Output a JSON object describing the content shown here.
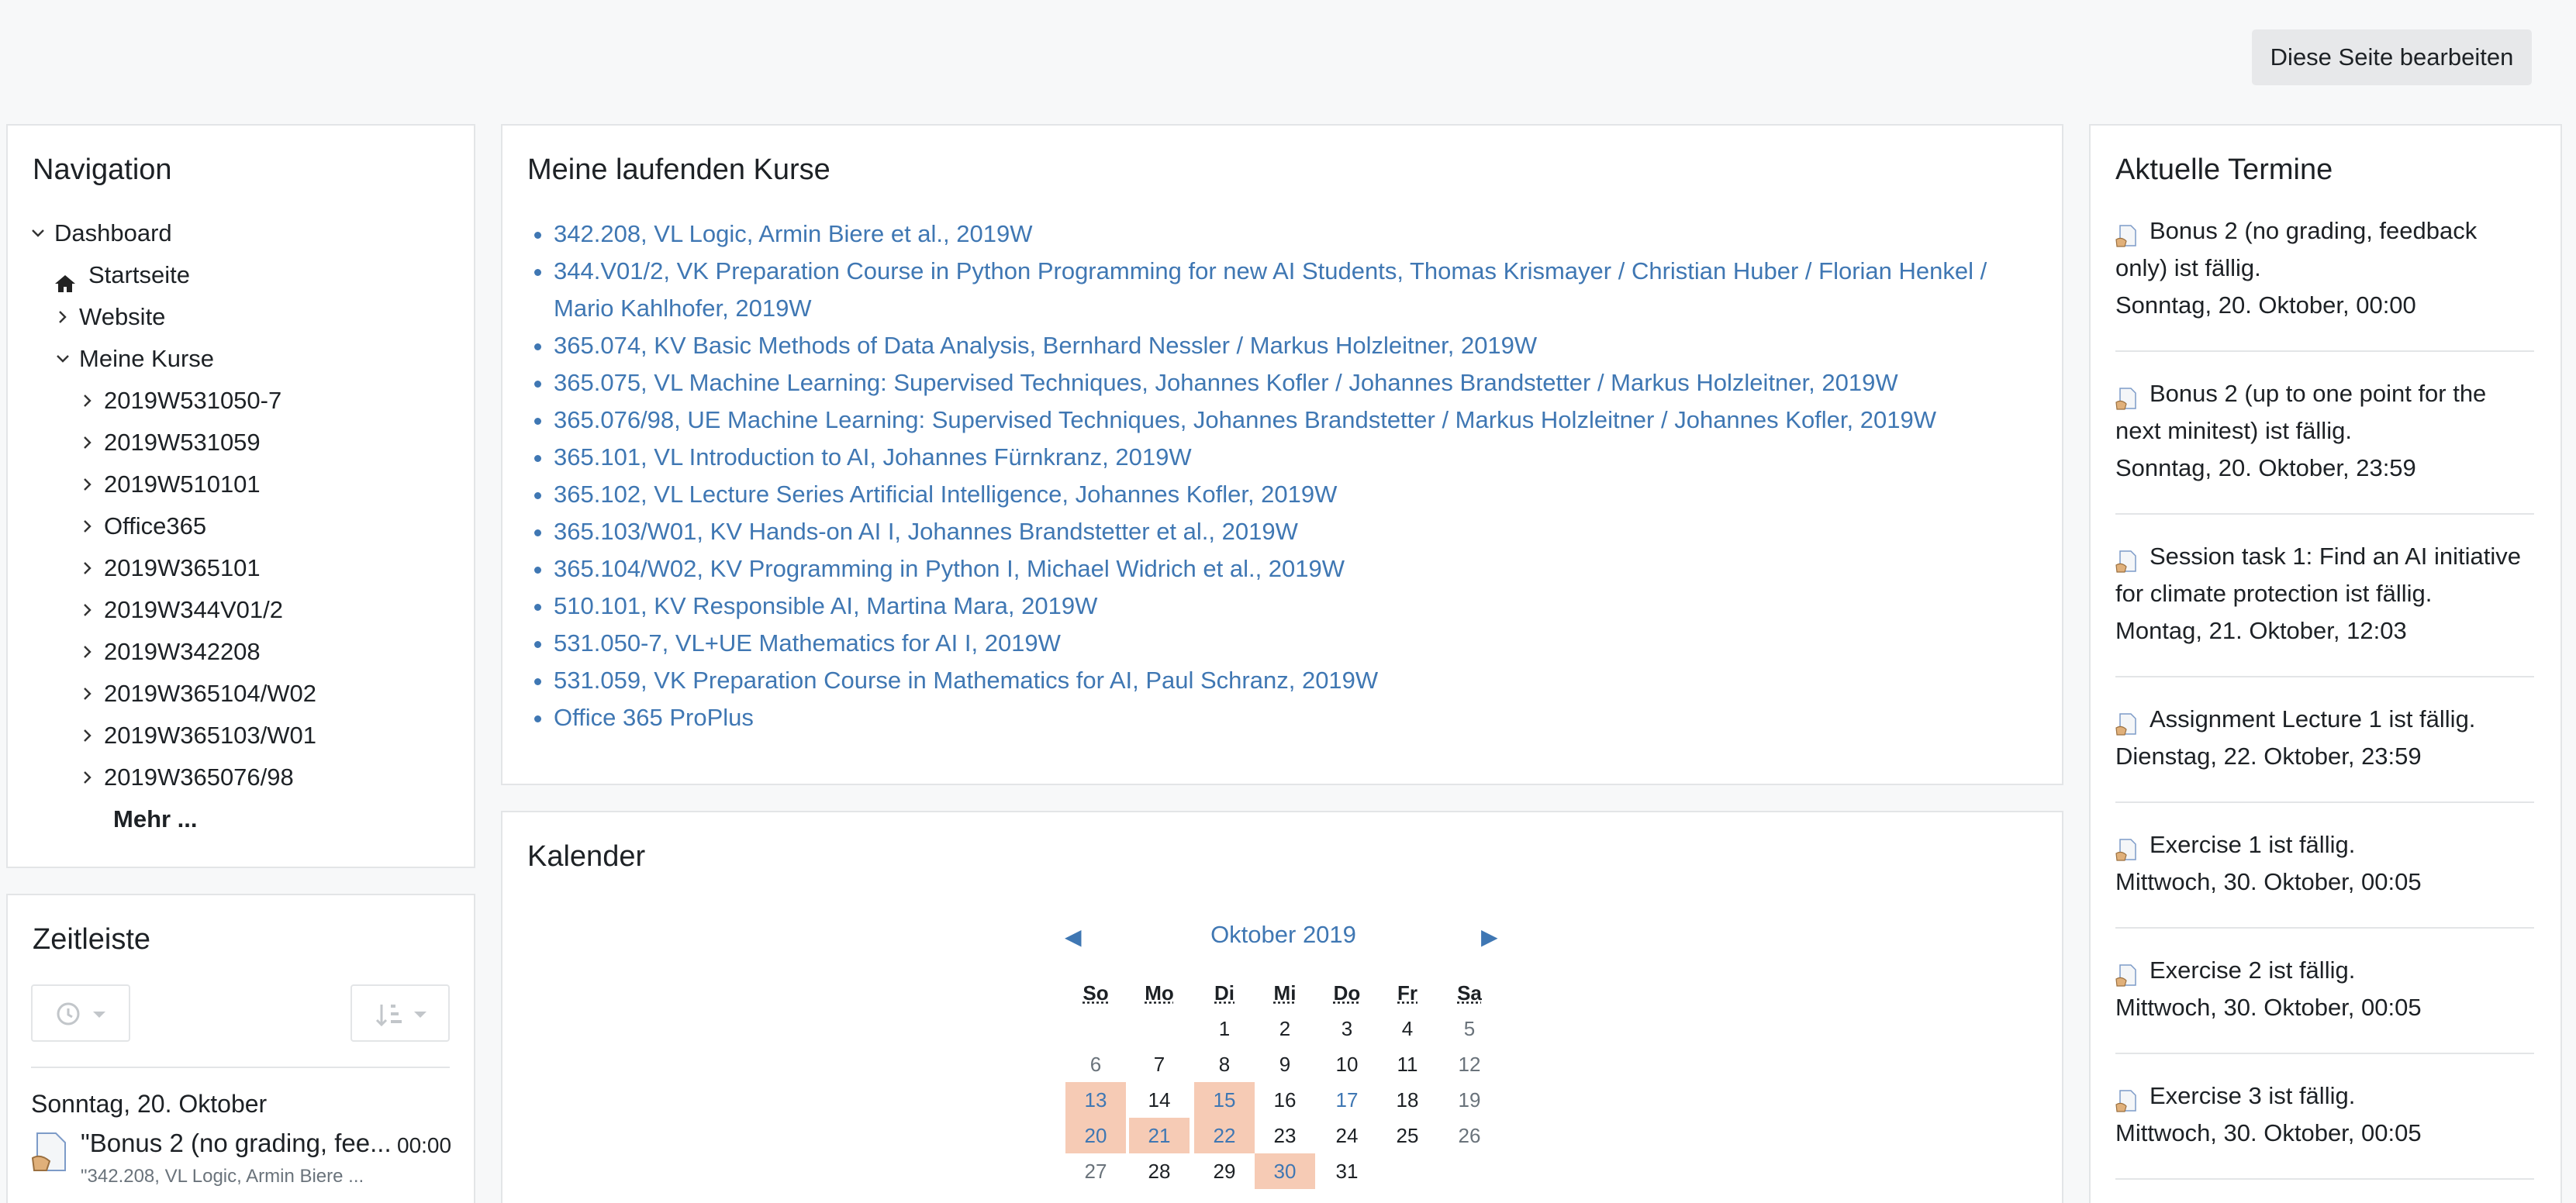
{
  "header": {
    "edit_button": "Diese Seite bearbeiten"
  },
  "navigation": {
    "title": "Navigation",
    "dashboard": "Dashboard",
    "startseite": "Startseite",
    "website": "Website",
    "meine_kurse": "Meine Kurse",
    "courses": [
      "2019W531050-7",
      "2019W531059",
      "2019W510101",
      "Office365",
      "2019W365101",
      "2019W344V01/2",
      "2019W342208",
      "2019W365104/W02",
      "2019W365103/W01",
      "2019W365076/98"
    ],
    "more": "Mehr ..."
  },
  "running_courses": {
    "title": "Meine laufenden Kurse",
    "items": [
      "342.208, VL Logic, Armin Biere et al., 2019W",
      "344.V01/2, VK Preparation Course in Python Programming for new AI Students, Thomas Krismayer / Christian Huber / Florian Henkel / Mario Kahlhofer, 2019W",
      "365.074, KV Basic Methods of Data Analysis, Bernhard Nessler / Markus Holzleitner, 2019W",
      "365.075, VL Machine Learning: Supervised Techniques, Johannes Kofler / Johannes Brandstetter / Markus Holzleitner, 2019W",
      "365.076/98, UE Machine Learning: Supervised Techniques, Johannes Brandstetter / Markus Holzleitner / Johannes Kofler, 2019W",
      "365.101, VL Introduction to AI, Johannes Fürnkranz, 2019W",
      "365.102, VL Lecture Series Artificial Intelligence, Johannes Kofler, 2019W",
      "365.103/W01, KV Hands-on AI I, Johannes Brandstetter et al., 2019W",
      "365.104/W02, KV Programming in Python I, Michael Widrich et al., 2019W",
      "510.101, KV Responsible AI, Martina Mara, 2019W",
      "531.050-7, VL+UE Mathematics for AI I, 2019W",
      "531.059, VK Preparation Course in Mathematics for AI, Paul Schranz, 2019W",
      "Office 365 ProPlus"
    ]
  },
  "calendar": {
    "title": "Kalender",
    "month": "Oktober 2019",
    "prev": "◀",
    "next": "▶",
    "weekdays": [
      "So",
      "Mo",
      "Di",
      "Mi",
      "Do",
      "Fr",
      "Sa"
    ],
    "weeks": [
      [
        "",
        "",
        "1",
        "2",
        "3",
        "4",
        "5"
      ],
      [
        "6",
        "7",
        "8",
        "9",
        "10",
        "11",
        "12"
      ],
      [
        "13",
        "14",
        "15",
        "16",
        "17",
        "18",
        "19"
      ],
      [
        "20",
        "21",
        "22",
        "23",
        "24",
        "25",
        "26"
      ],
      [
        "27",
        "28",
        "29",
        "30",
        "31",
        "",
        ""
      ]
    ],
    "highlighted": [
      "13",
      "15",
      "20",
      "21",
      "22",
      "30"
    ],
    "highlight_color": "#f6cbb5",
    "link_color": "#3f77b3"
  },
  "events": {
    "title": "Aktuelle Termine",
    "items": [
      {
        "title": "Bonus 2 (no grading, feedback only) ist fällig.",
        "date": "Sonntag, 20. Oktober, 00:00"
      },
      {
        "title": "Bonus 2 (up to one point for the next minitest) ist fällig.",
        "date": "Sonntag, 20. Oktober, 23:59"
      },
      {
        "title": "Session task 1: Find an AI initiative for climate protection ist fällig.",
        "date": "Montag, 21. Oktober, 12:03"
      },
      {
        "title": "Assignment Lecture 1 ist fällig.",
        "date": "Dienstag, 22. Oktober, 23:59"
      },
      {
        "title": "Exercise 1 ist fällig.",
        "date": "Mittwoch, 30. Oktober, 00:05"
      },
      {
        "title": "Exercise 2 ist fällig.",
        "date": "Mittwoch, 30. Oktober, 00:05"
      },
      {
        "title": "Exercise 3 ist fällig.",
        "date": "Mittwoch, 30. Oktober, 00:05"
      }
    ]
  },
  "timeline": {
    "title": "Zeitleiste",
    "day": "Sonntag, 20. Oktober",
    "item_title": "\"Bonus 2 (no grading, fee...",
    "item_time": "00:00",
    "item_course": "\"342.208, VL Logic, Armin Biere ..."
  }
}
